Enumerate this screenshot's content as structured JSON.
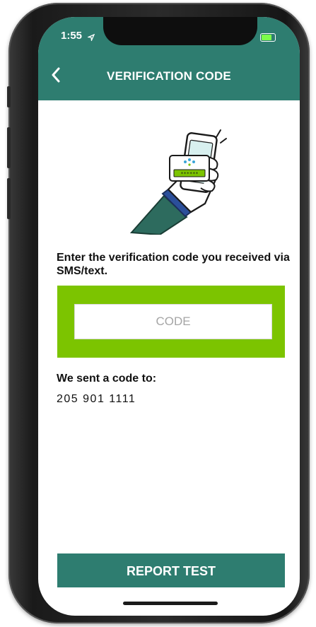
{
  "status": {
    "time": "1:55",
    "location_icon": "location-arrow-icon",
    "signal_icon": "cellular-signal-icon",
    "wifi_icon": "wifi-icon",
    "battery_icon": "battery-icon"
  },
  "nav": {
    "back_icon": "chevron-left-icon",
    "title": "VERIFICATION CODE"
  },
  "colors": {
    "brand_green": "#2e7d70",
    "highlight_green": "#7cc400",
    "battery_green": "#7cfc4a"
  },
  "illustration": {
    "icon": "hand-holding-phone-icon",
    "code_display": "******"
  },
  "form": {
    "prompt": "Enter the verification code you received via SMS/text.",
    "code_placeholder": "CODE",
    "code_value": ""
  },
  "recipient": {
    "label": "We sent a code to:",
    "phone_number": "205 901 1111"
  },
  "actions": {
    "report_test_label": "REPORT TEST"
  }
}
